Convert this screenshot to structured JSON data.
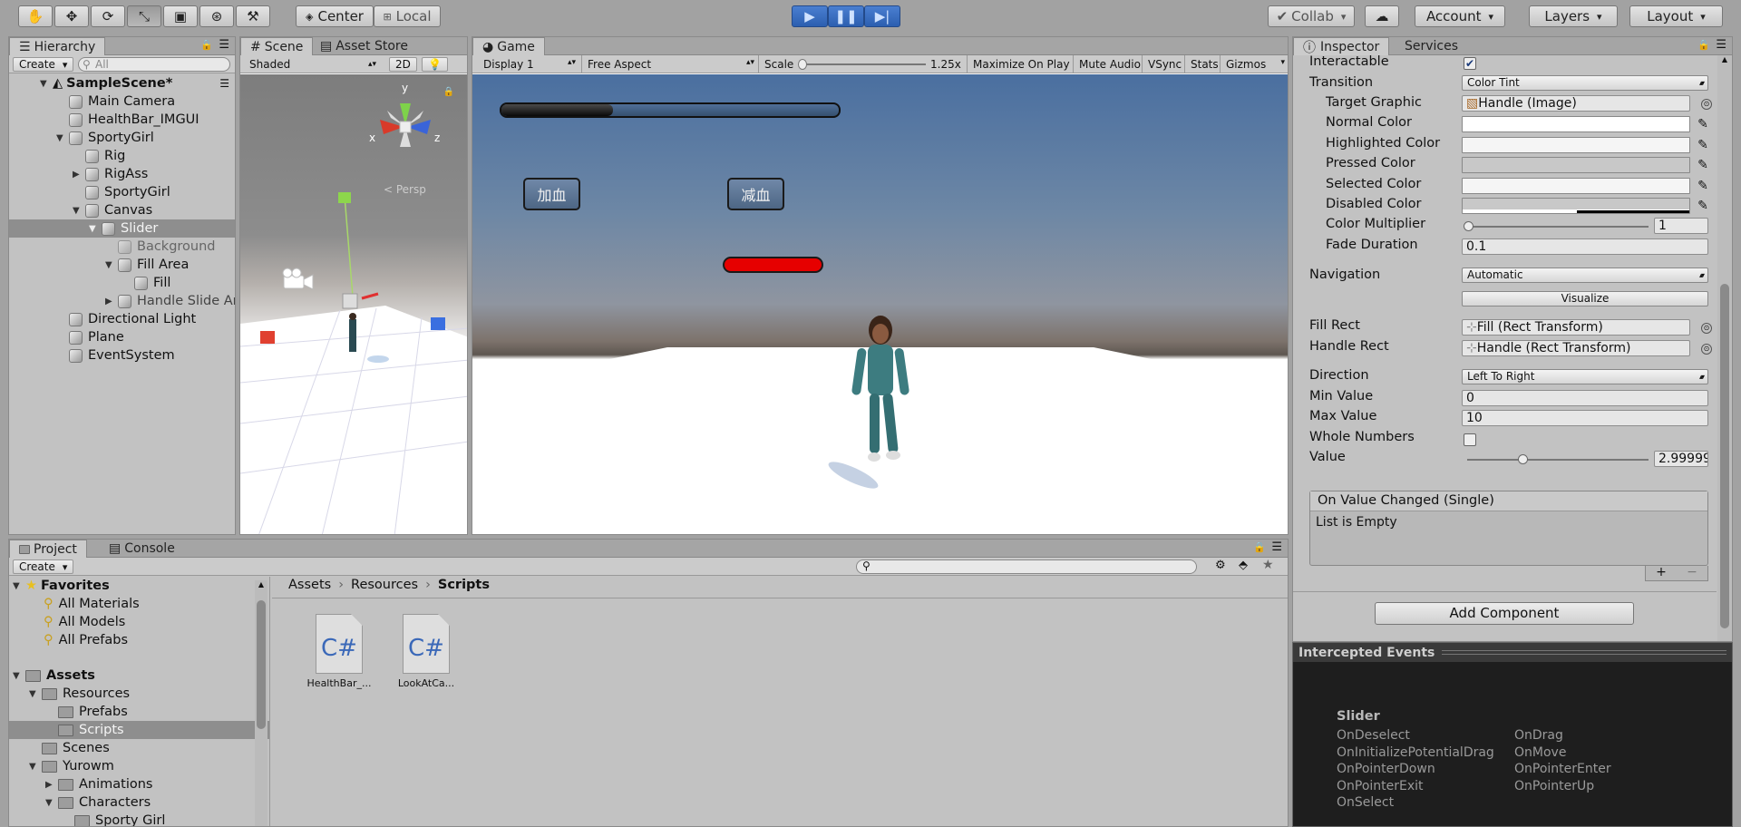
{
  "toolbar": {
    "pivot_center": "Center",
    "pivot_local": "Local",
    "collab": "Collab",
    "account": "Account",
    "layers": "Layers",
    "layout": "Layout"
  },
  "hierarchy": {
    "tab": "Hierarchy",
    "create": "Create",
    "search_placeholder": "All",
    "scene": "SampleScene*",
    "items": [
      {
        "label": "Main Camera"
      },
      {
        "label": "HealthBar_IMGUI"
      },
      {
        "label": "SportyGirl"
      },
      {
        "label": "Rig"
      },
      {
        "label": "RigAss"
      },
      {
        "label": "SportyGirl"
      },
      {
        "label": "Canvas"
      },
      {
        "label": "Slider"
      },
      {
        "label": "Background"
      },
      {
        "label": "Fill Area"
      },
      {
        "label": "Fill"
      },
      {
        "label": "Handle Slide Ar"
      },
      {
        "label": "Directional Light"
      },
      {
        "label": "Plane"
      },
      {
        "label": "EventSystem"
      }
    ]
  },
  "scene_view": {
    "tabs": [
      "Scene",
      "Asset Store"
    ],
    "shading": "Shaded",
    "mode_2d": "2D",
    "gizmo_y": "y",
    "gizmo_x": "x",
    "gizmo_z": "z",
    "persp": "< Persp"
  },
  "game_view": {
    "tab": "Game",
    "display": "Display 1",
    "aspect": "Free Aspect",
    "scale_label": "Scale",
    "scale_value": "1.25x",
    "maximize": "Maximize On Play",
    "mute": "Mute Audio",
    "vsync": "VSync",
    "stats": "Stats",
    "gizmos": "Gizmos",
    "health_fill": 0.33,
    "btn_add": "加血",
    "btn_sub": "减血"
  },
  "inspector": {
    "tabs": [
      "Inspector",
      "Services"
    ],
    "interactable_label": "Interactable",
    "transition_label": "Transition",
    "transition_value": "Color Tint",
    "target_graphic_label": "Target Graphic",
    "target_graphic_value": "Handle (Image)",
    "normal_color": "Normal Color",
    "highlighted_color": "Highlighted Color",
    "pressed_color": "Pressed Color",
    "selected_color": "Selected Color",
    "disabled_color": "Disabled Color",
    "color_multiplier_label": "Color Multiplier",
    "color_multiplier_value": "1",
    "fade_duration_label": "Fade Duration",
    "fade_duration_value": "0.1",
    "navigation_label": "Navigation",
    "navigation_value": "Automatic",
    "visualize": "Visualize",
    "fill_rect_label": "Fill Rect",
    "fill_rect_value": "Fill (Rect Transform)",
    "handle_rect_label": "Handle Rect",
    "handle_rect_value": "Handle (Rect Transform)",
    "direction_label": "Direction",
    "direction_value": "Left To Right",
    "min_value_label": "Min Value",
    "min_value": "0",
    "max_value_label": "Max Value",
    "max_value": "10",
    "whole_numbers_label": "Whole Numbers",
    "value_label": "Value",
    "value": "2.99999",
    "event_header": "On Value Changed (Single)",
    "event_body": "List is Empty",
    "add_component": "Add Component"
  },
  "intercepted": {
    "title": "Intercepted Events",
    "object": "Slider",
    "events_left": [
      "OnDeselect",
      "OnInitializePotentialDrag",
      "OnPointerDown",
      "OnPointerExit",
      "OnSelect"
    ],
    "events_right": [
      "OnDrag",
      "OnMove",
      "OnPointerEnter",
      "OnPointerUp"
    ]
  },
  "project": {
    "tabs": [
      "Project",
      "Console"
    ],
    "create": "Create",
    "favorites": "Favorites",
    "fav_items": [
      "All Materials",
      "All Models",
      "All Prefabs"
    ],
    "assets": "Assets",
    "tree": [
      "Resources",
      "Prefabs",
      "Scripts",
      "Scenes",
      "Yurowm",
      "Animations",
      "Characters",
      "Sporty Girl"
    ],
    "breadcrumb": [
      "Assets",
      "Resources",
      "Scripts"
    ],
    "files": [
      "HealthBar_...",
      "LookAtCa..."
    ],
    "file_icon_text": "C#"
  }
}
